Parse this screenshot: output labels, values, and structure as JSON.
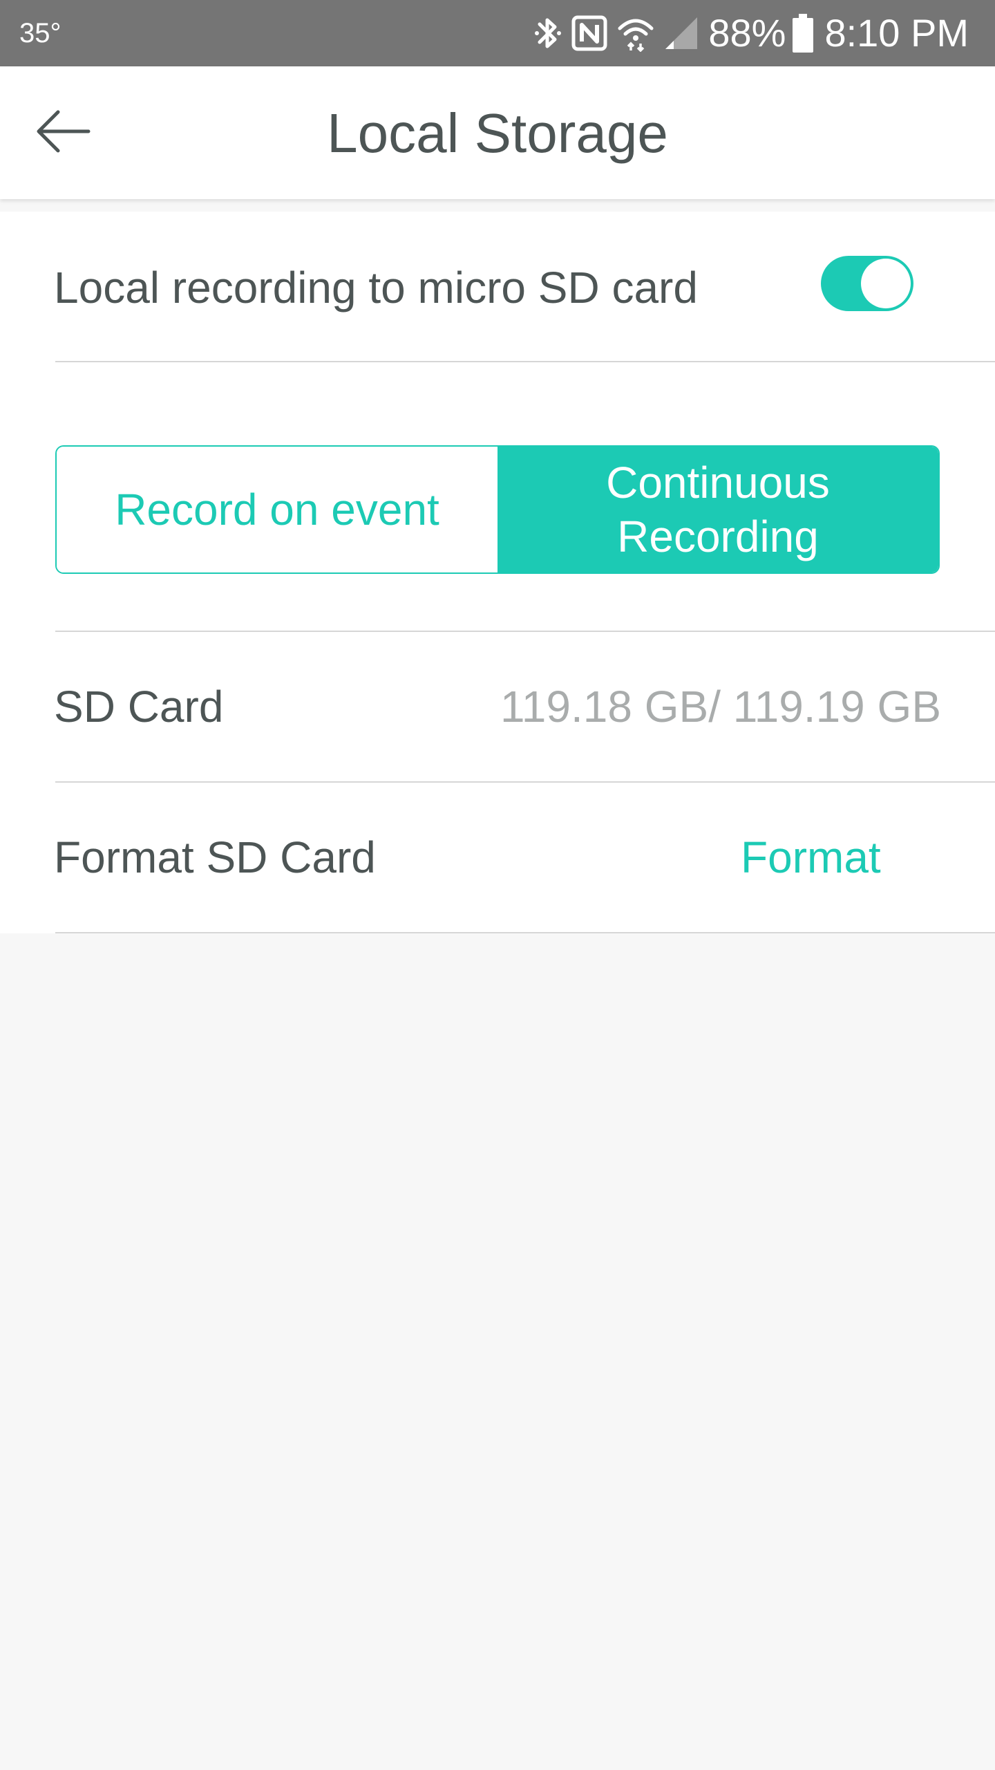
{
  "status_bar": {
    "temperature": "35°",
    "battery_percent": "88%",
    "time": "8:10 PM",
    "icons": [
      "bluetooth-icon",
      "nfc-icon",
      "wifi-icon",
      "cell-signal-icon",
      "battery-icon"
    ]
  },
  "app_bar": {
    "title": "Local Storage",
    "back_icon": "arrow-left-icon"
  },
  "settings": {
    "local_recording": {
      "label": "Local recording to micro SD card",
      "enabled": true
    },
    "recording_mode": {
      "options": [
        "Record on event",
        "Continuous Recording"
      ],
      "selected": "Continuous Recording"
    },
    "sd_card": {
      "label": "SD Card",
      "value": "119.18 GB/ 119.19 GB"
    },
    "format": {
      "label": "Format SD Card",
      "action": "Format"
    }
  },
  "colors": {
    "accent": "#1ccab4",
    "status_bar": "#757575",
    "text": "#4d5555",
    "muted_text": "#a9acac",
    "background": "#f7f7f7"
  }
}
